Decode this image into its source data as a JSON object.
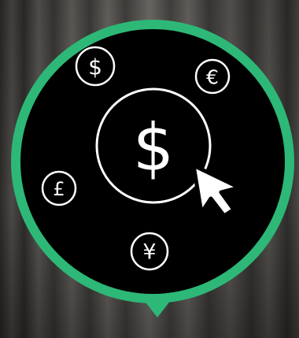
{
  "theme": {
    "accent": "#2db877",
    "disc": "#000000",
    "symbol_color": "#ffffff",
    "backdrop": "curtain-texture"
  },
  "badge": {
    "center_symbol": "$",
    "center_icon": "dollar-icon",
    "pointer_icon": "mouse-cursor-icon",
    "currencies": [
      {
        "name": "dollar",
        "symbol": "$",
        "icon": "dollar-coin-icon"
      },
      {
        "name": "euro",
        "symbol": "€",
        "icon": "euro-coin-icon"
      },
      {
        "name": "pound",
        "symbol": "£",
        "icon": "pound-coin-icon"
      },
      {
        "name": "yen",
        "symbol": "¥",
        "icon": "yen-coin-icon"
      }
    ]
  }
}
